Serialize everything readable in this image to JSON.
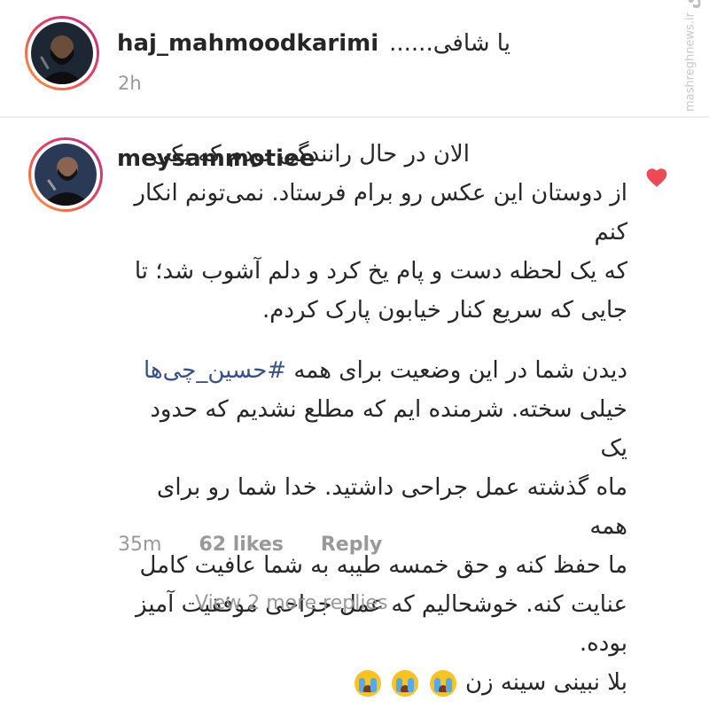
{
  "post": {
    "username": "haj_mahmoodkarimi",
    "caption": "یا شافی......",
    "time": "2h"
  },
  "comment": {
    "username": "meysammotiee",
    "lines_p1": [
      "الان در حال رانندگی بودم که یکی",
      "از دوستان این عکس رو برام فرستاد. نمی‌تونم انکار کنم",
      "که یک لحظه دست و پام یخ کرد و دلم آشوب شد؛ تا",
      "جایی که سریع کنار خیابون پارک کردم."
    ],
    "p2_before_hashtag": "دیدن شما در این وضعیت برای همه",
    "hashtag": "#حسین_چی‌ها",
    "lines_p2": [
      "خیلی سخته. شرمنده ایم که مطلع نشدیم که حدود یک",
      "ماه گذشته عمل جراحی داشتید. خدا شما رو برای همه",
      "ما حفظ کنه و حق خمسه طیبه به شما عافیت کامل",
      "عنایت کنه. خوشحالیم که عمل جراحی موفقیت آمیز",
      "بوده."
    ],
    "last_line": "بلا نبینی سینه زن",
    "emoji_icon": "crying-face-icon",
    "time": "35m",
    "likes": "62 likes",
    "reply": "Reply",
    "liked": true,
    "heart_color": "#ed4956"
  },
  "view_replies": "View 2 more replies",
  "watermark": {
    "logo": "مشرق",
    "url": "mashreghnews.ir"
  },
  "colors": {
    "hashtag": "#385185",
    "muted": "#999999",
    "text": "#262626"
  }
}
